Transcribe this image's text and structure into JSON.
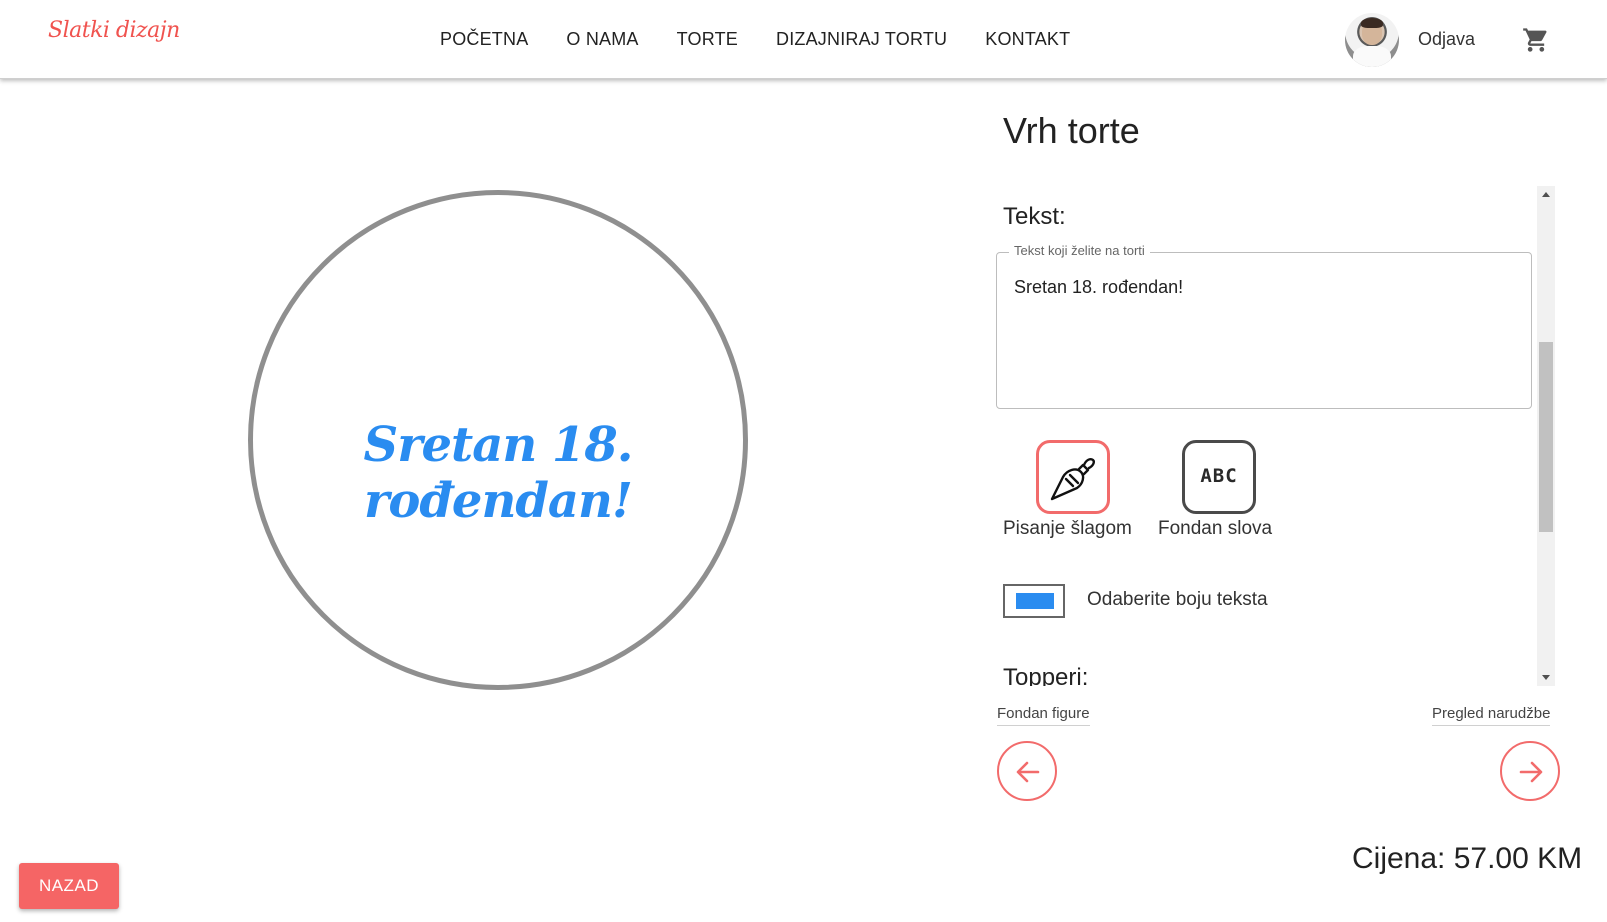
{
  "brand": {
    "logo_text": "Slatki dizajn",
    "accent_color": "#f56565"
  },
  "nav": {
    "items": [
      "POČETNA",
      "O NAMA",
      "TORTE",
      "DIZAJNIRAJ TORTU",
      "KONTAKT"
    ]
  },
  "user": {
    "logout_label": "Odjava"
  },
  "icons": {
    "cart": "cart-icon",
    "avatar": "user-avatar",
    "piping": "piping-bag-icon",
    "fondant": "abc-icon"
  },
  "preview": {
    "text": "Sretan 18. rođendan!",
    "text_color": "#2a8cf0"
  },
  "panel": {
    "title": "Vrh torte",
    "text_section_label": "Tekst:",
    "text_field": {
      "legend": "Tekst koji želite na torti",
      "value": "Sretan 18. rođendan!"
    },
    "writing_options": [
      {
        "label": "Pisanje šlagom",
        "selected": true
      },
      {
        "label": "Fondan slova",
        "selected": false
      }
    ],
    "fondant_icon_text": "ABC",
    "color_picker_label": "Odaberite boju teksta",
    "selected_text_color": "#2a8cf0",
    "toppers_label": "Topperi:"
  },
  "steps": {
    "prev_label": "Fondan figure",
    "next_label": "Pregled narudžbe"
  },
  "price_text": "Cijena: 57.00 KM",
  "back_button_label": "NAZAD"
}
